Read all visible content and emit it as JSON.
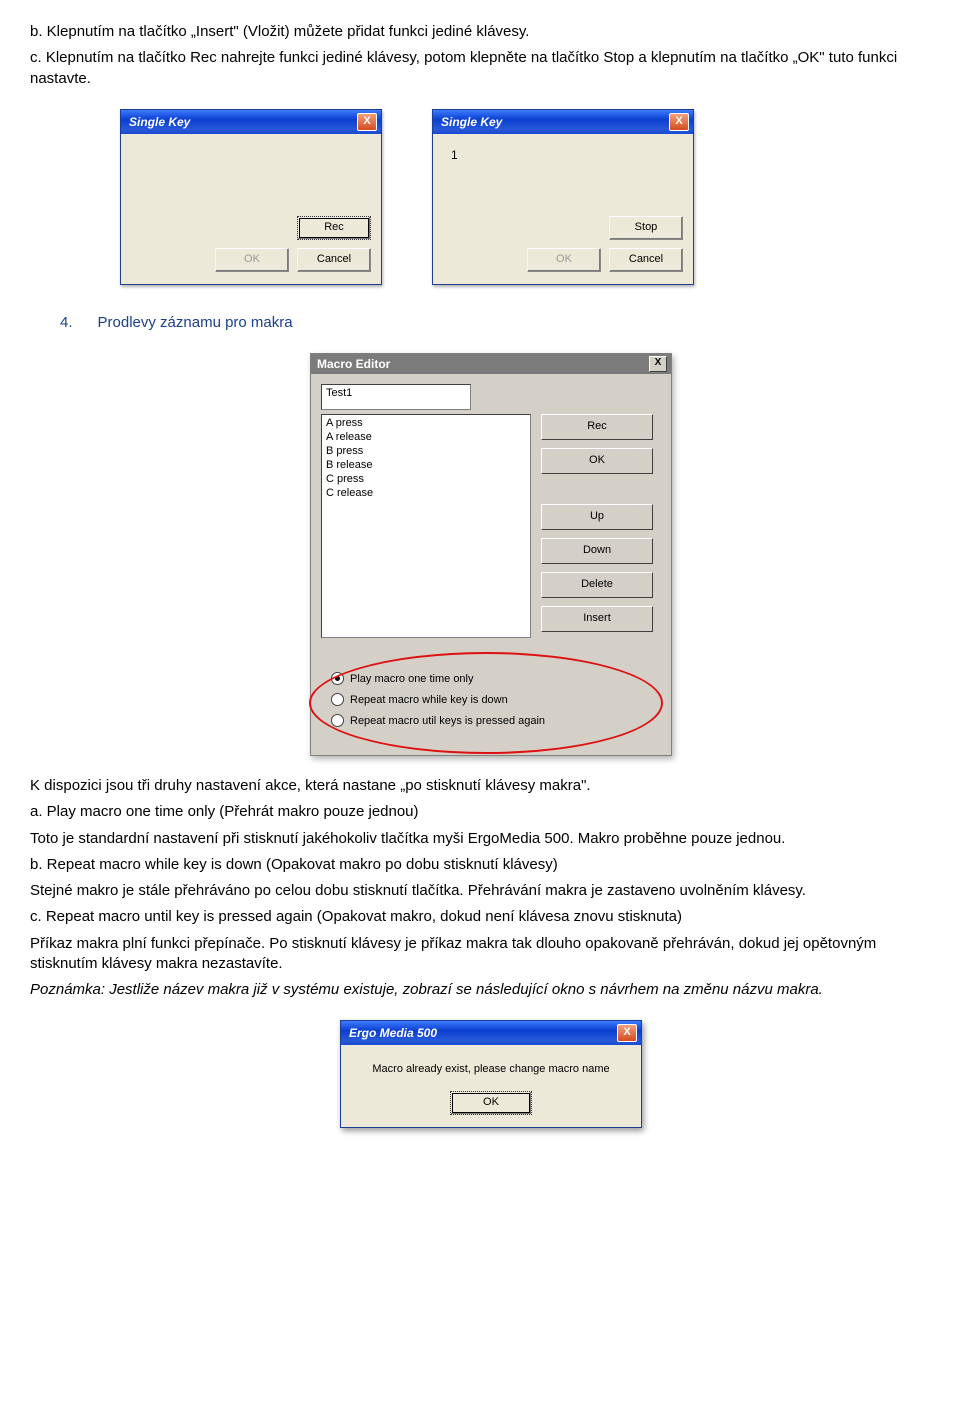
{
  "para_b": "b. Klepnutím na tlačítko „Insert\" (Vložit) můžete přidat funkci jediné klávesy.",
  "para_c": "c. Klepnutím na tlačítko Rec nahrejte funkci jediné klávesy, potom klepněte na tlačítko Stop a klepnutím na tlačítko „OK\" tuto funkci nastavte.",
  "singlekey": {
    "title": "Single Key",
    "close": "X",
    "rec": "Rec",
    "stop": "Stop",
    "ok": "OK",
    "cancel": "Cancel",
    "value2": "1"
  },
  "section4": "4.      Prodlevy záznamu pro makra",
  "macroeditor": {
    "title": "Macro Editor",
    "close": "X",
    "name": "Test1",
    "list": "A press\nA release\nB press\nB release\nC press\nC release",
    "rec": "Rec",
    "ok": "OK",
    "up": "Up",
    "down": "Down",
    "delete": "Delete",
    "insert": "Insert",
    "radio1": "Play macro one time only",
    "radio2": "Repeat macro while key is down",
    "radio3": "Repeat macro util keys is pressed again"
  },
  "text_k": "K dispozici jsou tři druhy nastavení akce, která nastane „po stisknutí klávesy makra\".",
  "text_a": "a. Play macro one time only (Přehrát makro pouze jednou)",
  "text_a2": "Toto je standardní nastavení při stisknutí jakéhokoliv tlačítka myši ErgoMedia 500. Makro proběhne pouze jednou.",
  "text_b2": "b. Repeat macro while key is down (Opakovat makro po dobu stisknutí klávesy)",
  "text_b3": "Stejné makro je stále přehráváno po celou dobu stisknutí tlačítka. Přehrávání makra je zastaveno uvolněním klávesy.",
  "text_c2": "c. Repeat macro until key is pressed again (Opakovat makro, dokud není klávesa znovu stisknuta)",
  "text_c3": "Příkaz makra plní funkci přepínače. Po stisknutí klávesy je příkaz makra tak dlouho opakovaně přehráván, dokud jej opětovným stisknutím klávesy makra nezastavíte.",
  "note": "Poznámka: Jestliže název makra již v systému existuje, zobrazí se následující okno s návrhem na změnu názvu makra.",
  "ergo": {
    "title": "Ergo Media 500",
    "close": "X",
    "msg": "Macro already exist, please change macro name",
    "ok": "OK"
  }
}
